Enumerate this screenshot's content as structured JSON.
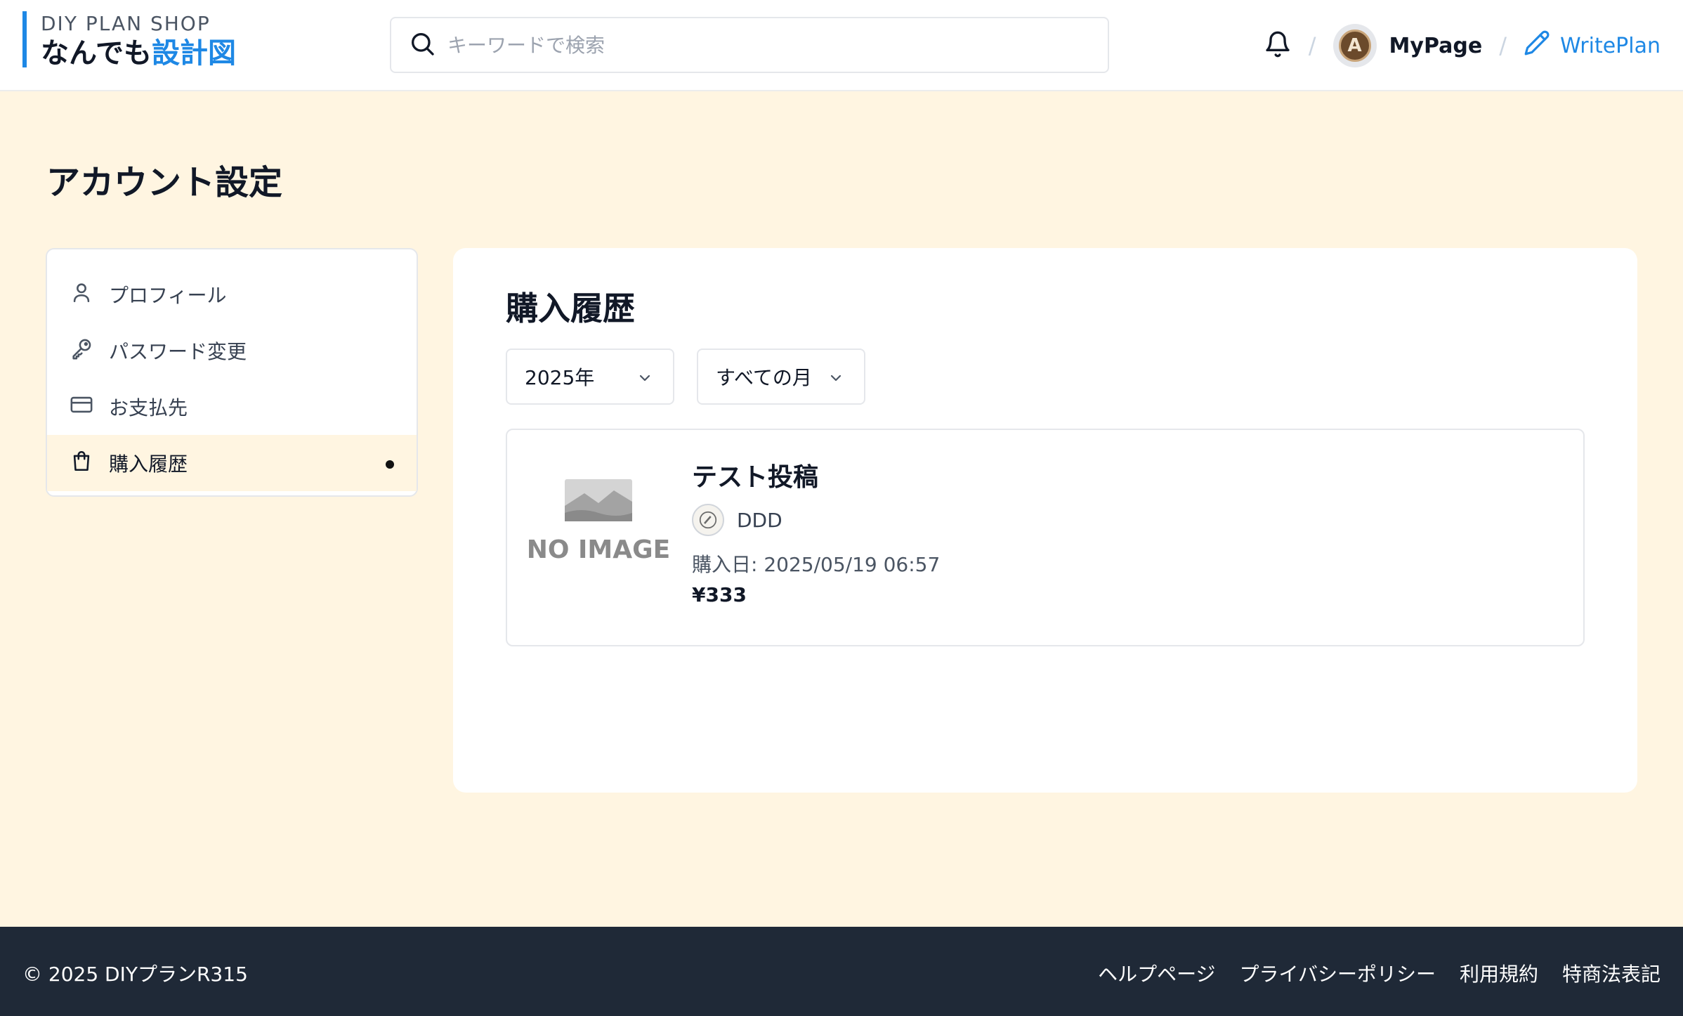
{
  "header": {
    "brand_sub": "DIY PLAN SHOP",
    "brand_main_prefix": "なんでも",
    "brand_main_accent": "設計図",
    "search_placeholder": "キーワードで検索",
    "separator": "/",
    "avatar_letter": "A",
    "mypage_label": "MyPage",
    "writeplan_label": "WritePlan",
    "accent_color": "#1e88e5"
  },
  "page": {
    "title": "アカウント設定"
  },
  "sidebar": {
    "items": [
      {
        "label": "プロフィール",
        "icon": "user-icon"
      },
      {
        "label": "パスワード変更",
        "icon": "key-icon"
      },
      {
        "label": "お支払先",
        "icon": "credit-card-icon"
      },
      {
        "label": "購入履歴",
        "icon": "shopping-bag-icon",
        "active": true
      }
    ]
  },
  "main": {
    "title": "購入履歴",
    "year_select": "2025年",
    "month_select": "すべての月",
    "purchases": [
      {
        "title": "テスト投稿",
        "author": "DDD",
        "date": "購入日: 2025/05/19 06:57",
        "price": "¥333",
        "thumbnail_text": "NO IMAGE"
      }
    ]
  },
  "footer": {
    "copyright": "© 2025 DIYプランR315",
    "links": [
      "ヘルプページ",
      "プライバシーポリシー",
      "利用規約",
      "特商法表記"
    ]
  }
}
